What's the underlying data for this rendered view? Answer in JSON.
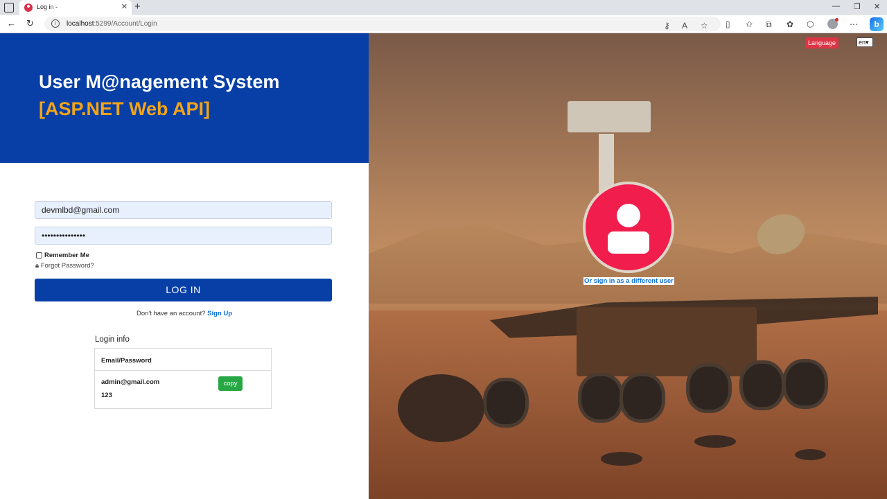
{
  "browser": {
    "tab_title": "Log in -",
    "url_host": "localhost",
    "url_path": ":5299/Account/Login"
  },
  "app": {
    "title": "User M@nagement System",
    "subtitle": "[ASP.NET Web API]"
  },
  "form": {
    "email_value": "devmlbd@gmail.com",
    "password_value": "•••••••••••••••",
    "remember_label": "Remember Me",
    "forgot_label": "Forgot Password?",
    "login_button": "LOG IN",
    "no_account_text": "Don't have an account?",
    "signup_link": "Sign Up"
  },
  "login_info": {
    "label": "Login info",
    "header": "Email/Password",
    "email": "admin@gmail.com",
    "password": "123",
    "copy_button": "copy"
  },
  "right_panel": {
    "language_button": "Language",
    "language_value": "en",
    "different_user_link": "Or sign in as a different user"
  },
  "colors": {
    "primary": "#073fa6",
    "accent": "#f4a418",
    "danger": "#dc3545",
    "success": "#28a745",
    "avatar": "#f11d4d"
  }
}
